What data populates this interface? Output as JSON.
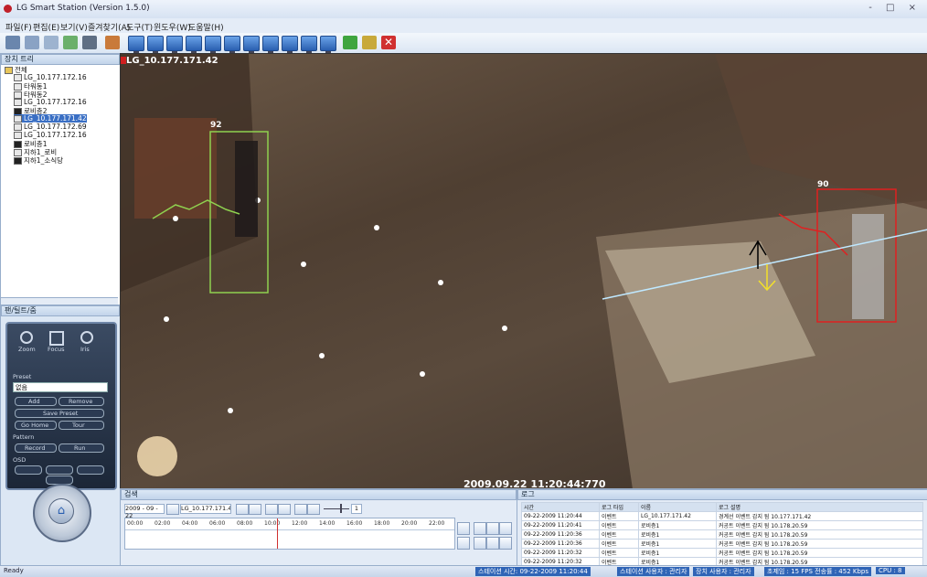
{
  "window": {
    "title": "LG Smart Station (Version 1.5.0)",
    "controls": "- □ ×"
  },
  "menu": [
    "파일(F)",
    "편집(E)",
    "보기(V)",
    "즐겨찾기(A)",
    "도구(T)",
    "윈도우(W)",
    "도움말(H)"
  ],
  "tree": {
    "title": "장치 트리",
    "items": [
      {
        "label": "전체",
        "kind": "folder"
      },
      {
        "label": "LG_10.177.172.16",
        "kind": "cam"
      },
      {
        "label": "타워동1",
        "kind": "cam"
      },
      {
        "label": "타워동2",
        "kind": "cam"
      },
      {
        "label": "LG_10.177.172.16",
        "kind": "cam"
      },
      {
        "label": "로비층2",
        "kind": "dark"
      },
      {
        "label": "LG_10.177.171.42",
        "kind": "cam",
        "selected": true
      },
      {
        "label": "LG_10.177.172.69",
        "kind": "cam"
      },
      {
        "label": "LG_10.177.172.16",
        "kind": "cam"
      },
      {
        "label": "로비층1",
        "kind": "dark"
      },
      {
        "label": "지하1_로비",
        "kind": "cam"
      },
      {
        "label": "지하1_소식당",
        "kind": "dark"
      }
    ]
  },
  "ptz": {
    "title": "팬/틸트/줌",
    "zoom_labels": [
      "Zoom",
      "Focus",
      "Iris"
    ],
    "preset_label": "Preset",
    "preset_value": "없음",
    "preset_buttons": [
      "Add",
      "Remove",
      "Save Preset",
      "Go Home",
      "Tour"
    ],
    "pattern_label": "Pattern",
    "pattern_buttons": [
      "Record",
      "Run"
    ],
    "osd_label": "OSD"
  },
  "video": {
    "camera": "LG_10.177.171.42",
    "timestamp": "2009.09.22 11:20:44:770",
    "objects": [
      {
        "id": "92",
        "color": "#8fd14f"
      },
      {
        "id": "90",
        "color": "#e02020"
      }
    ]
  },
  "search": {
    "title": "검색",
    "date": "2009 - 09 - 22",
    "camera": "LG_10.177.171.42",
    "page": "1",
    "hours": [
      "00:00",
      "02:00",
      "04:00",
      "06:00",
      "08:00",
      "10:00",
      "12:00",
      "14:00",
      "16:00",
      "18:00",
      "20:00",
      "22:00"
    ]
  },
  "log": {
    "title": "로그",
    "columns": [
      "시간",
      "로그 타입",
      "이름",
      "로그 설명"
    ],
    "rows": [
      [
        "09-22-2009 11:20:44",
        "이벤트",
        "LG_10.177.171.42",
        "경계선 이벤트 감지 됨 10.177.171.42"
      ],
      [
        "09-22-2009 11:20:41",
        "이벤트",
        "로비층1",
        "커공트 이벤트 감지 됨 10.178.20.59"
      ],
      [
        "09-22-2009 11:20:36",
        "이벤트",
        "로비층1",
        "커공트 이벤트 감지 됨 10.178.20.59"
      ],
      [
        "09-22-2009 11:20:36",
        "이벤트",
        "로비층1",
        "커공트 이벤트 감지 됨 10.178.20.59"
      ],
      [
        "09-22-2009 11:20:32",
        "이벤트",
        "로비층1",
        "커공트 이벤트 감지 됨 10.178.20.59"
      ],
      [
        "09-22-2009 11:20:32",
        "이벤트",
        "로비층1",
        "커공트 이벤트 감지 됨 10.178.20.59"
      ]
    ]
  },
  "status": {
    "ready": "Ready",
    "connect_time": "스테이션 시간: 09-22-2009 11:20:44",
    "station_user": "스테이션 사용자 : 관리자",
    "device_user": "장치 사용자 : 관리자",
    "fps": "초제임 : 15 FPS  전송률 : 452 Kbps",
    "cpu": "CPU : 8"
  }
}
